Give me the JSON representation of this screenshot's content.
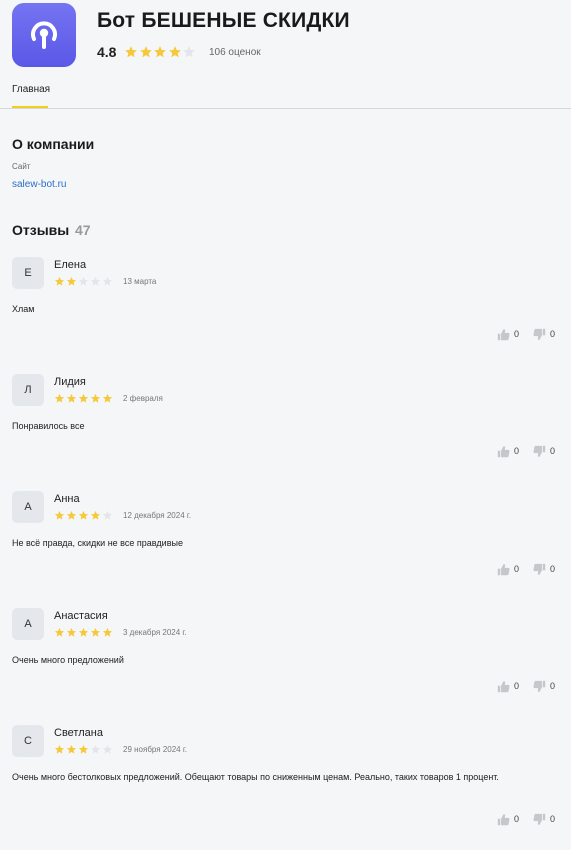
{
  "app": {
    "title": "Бот БЕШЕНЫЕ СКИДКИ",
    "rating": "4.8",
    "rating_stars": 4,
    "rating_count": "106 оценок",
    "icon": "broadcast-signal-icon",
    "icon_color": "#6866ee"
  },
  "tabs": [
    {
      "label": "Главная",
      "active": true
    }
  ],
  "about": {
    "title": "О компании",
    "site_label": "Сайт",
    "site_link": "salew-bot.ru"
  },
  "reviews": {
    "title": "Отзывы",
    "count": "47",
    "items": [
      {
        "initial": "Е",
        "name": "Елена",
        "stars": 2,
        "date": "13 марта",
        "text": "Хлам",
        "likes": "0",
        "dislikes": "0"
      },
      {
        "initial": "Л",
        "name": "Лидия",
        "stars": 5,
        "date": "2 февраля",
        "text": "Понравилось все",
        "likes": "0",
        "dislikes": "0"
      },
      {
        "initial": "А",
        "name": "Анна",
        "stars": 4,
        "date": "12 декабря 2024 г.",
        "text": "Не всё правда, скидки не все правдивые",
        "likes": "0",
        "dislikes": "0"
      },
      {
        "initial": "А",
        "name": "Анастасия",
        "stars": 5,
        "date": "3 декабря 2024 г.",
        "text": "Очень много предложений",
        "likes": "0",
        "dislikes": "0"
      },
      {
        "initial": "С",
        "name": "Светлана",
        "stars": 3,
        "date": "29 ноября 2024 г.",
        "text": "Очень много бестолковых предложений. Обещают товары по сниженным ценам. Реально, таких товаров 1 процент.",
        "likes": "0",
        "dislikes": "0"
      }
    ]
  },
  "colors": {
    "star_filled": "#f7c83a",
    "star_empty": "#e3e5e9",
    "accent": "#f2cf1a",
    "link": "#2a6fc9"
  }
}
